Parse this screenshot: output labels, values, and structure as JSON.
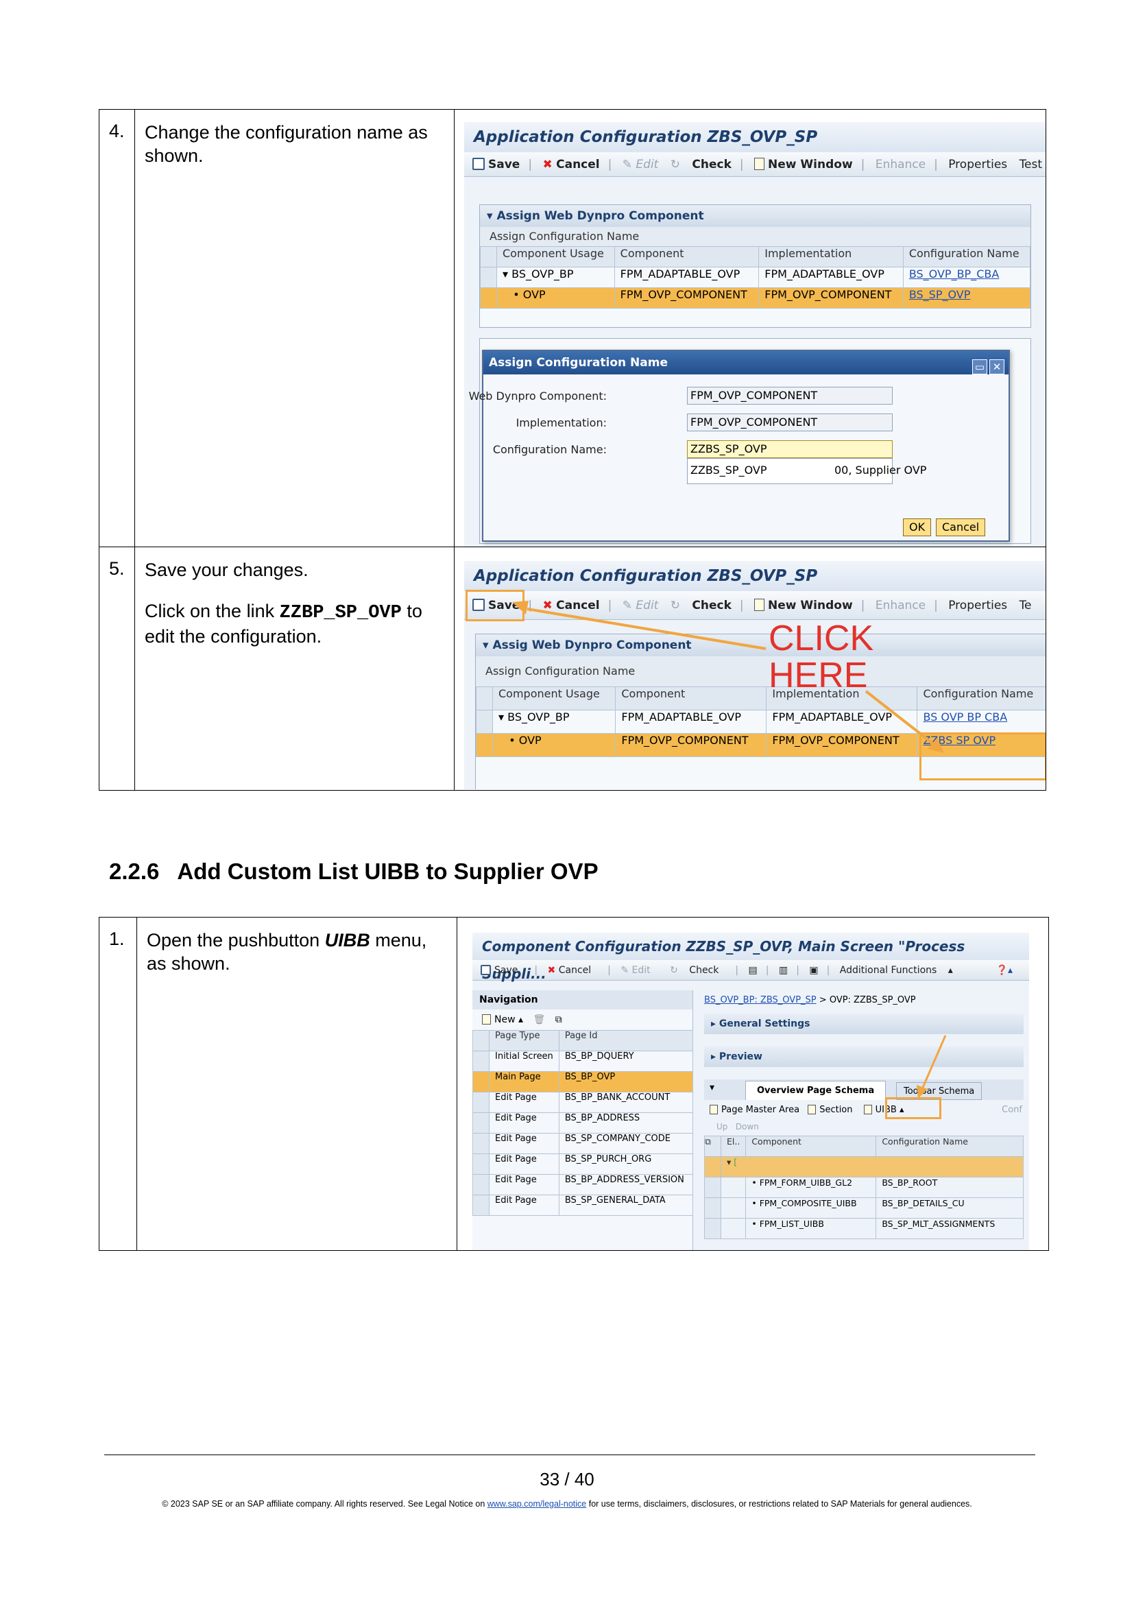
{
  "steps_a": [
    {
      "num": "4.",
      "text": "Change the configuration name as shown.",
      "screen": {
        "title": "Application Configuration ZBS_OVP_SP",
        "toolbar": [
          "Save",
          "Cancel",
          "Edit",
          "Check",
          "New Window",
          "Enhance",
          "Properties",
          "Test"
        ],
        "panel_title": "Assign Web Dynpro Component",
        "sub_title": "Assign Configuration Name",
        "columns": [
          "Component Usage",
          "Component",
          "Implementation",
          "Configuration Name"
        ],
        "rows": [
          [
            "BS_OVP_BP",
            "FPM_ADAPTABLE_OVP",
            "FPM_ADAPTABLE_OVP",
            "BS_OVP_BP_CBA"
          ],
          [
            "OVP",
            "FPM_OVP_COMPONENT",
            "FPM_OVP_COMPONENT",
            "BS_SP_OVP"
          ]
        ],
        "dialog": {
          "title": "Assign Configuration Name",
          "fields": [
            {
              "label": "Web Dynpro Component:",
              "value": "FPM_OVP_COMPONENT"
            },
            {
              "label": "Implementation:",
              "value": "FPM_OVP_COMPONENT"
            },
            {
              "label": "Configuration Name:",
              "value": "ZZBS_SP_OVP"
            }
          ],
          "suggestion_name": "ZZBS_SP_OVP",
          "suggestion_desc": "00, Supplier OVP",
          "ok": "OK",
          "cancel": "Cancel"
        }
      }
    },
    {
      "num": "5.",
      "text1": "Save your changes.",
      "text2_pre": "Click on the link ",
      "text2_code": "ZZBP_SP_OVP",
      "text2_post": " to edit the configuration.",
      "screen": {
        "title": "Application Configuration ZBS_OVP_SP",
        "toolbar": [
          "Save",
          "Cancel",
          "Edit",
          "Check",
          "New Window",
          "Enhance",
          "Properties",
          "Te"
        ],
        "panel_title": "Assig  Web Dynpro Component",
        "sub_title": "Assign Configuration Name",
        "columns": [
          "Component Usage",
          "Component",
          "Implementation",
          "Configuration Name"
        ],
        "rows": [
          [
            "BS_OVP_BP",
            "FPM_ADAPTABLE_OVP",
            "FPM_ADAPTABLE_OVP",
            "BS OVP BP CBA"
          ],
          [
            "OVP",
            "FPM_OVP_COMPONENT",
            "FPM_OVP_COMPONENT",
            "ZZBS SP OVP"
          ]
        ],
        "callout": "CLICK HERE"
      }
    }
  ],
  "section": {
    "number": "2.2.6",
    "title": "Add Custom List UIBB to Supplier OVP"
  },
  "steps_b": [
    {
      "num": "1.",
      "text_pre": "Open the pushbutton ",
      "text_em": "UIBB",
      "text_post": " menu, as shown.",
      "screen": {
        "title": "Component Configuration ZZBS_SP_OVP, Main Screen \"Process Suppli...",
        "toolbar": [
          "Save",
          "Cancel",
          "Edit",
          "Check",
          "Additional Functions"
        ],
        "nav_title": "Navigation",
        "nav_new": "New",
        "nav_columns": [
          "Page Type",
          "Page Id"
        ],
        "nav_rows": [
          [
            "Initial Screen",
            "BS_BP_DQUERY"
          ],
          [
            "Main Page",
            "BS_BP_OVP"
          ],
          [
            "Edit Page",
            "BS_BP_BANK_ACCOUNT"
          ],
          [
            "Edit Page",
            "BS_BP_ADDRESS"
          ],
          [
            "Edit Page",
            "BS_SP_COMPANY_CODE"
          ],
          [
            "Edit Page",
            "BS_SP_PURCH_ORG"
          ],
          [
            "Edit Page",
            "BS_BP_ADDRESS_VERSION"
          ],
          [
            "Edit Page",
            "BS_SP_GENERAL_DATA"
          ]
        ],
        "breadcrumb_link": "BS_OVP_BP: ZBS_OVP_SP",
        "breadcrumb_sep": ">",
        "breadcrumb_current": "OVP: ZZBS_SP_OVP",
        "general_settings": "General Settings",
        "preview": "Preview",
        "tab_active": "Overview Page Schema",
        "tab_inactive": "Toolbar Schema",
        "schema_toolbar": [
          "Page Master Area",
          "Section",
          "UIBB",
          "Conf"
        ],
        "up": "Up",
        "down": "Down",
        "schema_columns": [
          "El..",
          "Component",
          "Configuration Name"
        ],
        "schema_rows": [
          [
            "FPM_FORM_UIBB_GL2",
            "BS_BP_ROOT"
          ],
          [
            "FPM_COMPOSITE_UIBB",
            "BS_BP_DETAILS_CU"
          ],
          [
            "FPM_LIST_UIBB",
            "BS_SP_MLT_ASSIGNMENTS"
          ]
        ]
      }
    }
  ],
  "footer": {
    "page": "33 / 40",
    "legal_pre": "© 2023 SAP SE or an SAP affiliate company. All rights reserved. See Legal Notice on ",
    "legal_link": "www.sap.com/legal-notice",
    "legal_post": "  for use terms, disclaimers, disclosures, or restrictions related to SAP Materials for general audiences."
  },
  "colors": {
    "highlight": "#f1a640",
    "callout": "#e2322b",
    "selected_row": "#f5ba4f",
    "link": "#2050b0"
  }
}
